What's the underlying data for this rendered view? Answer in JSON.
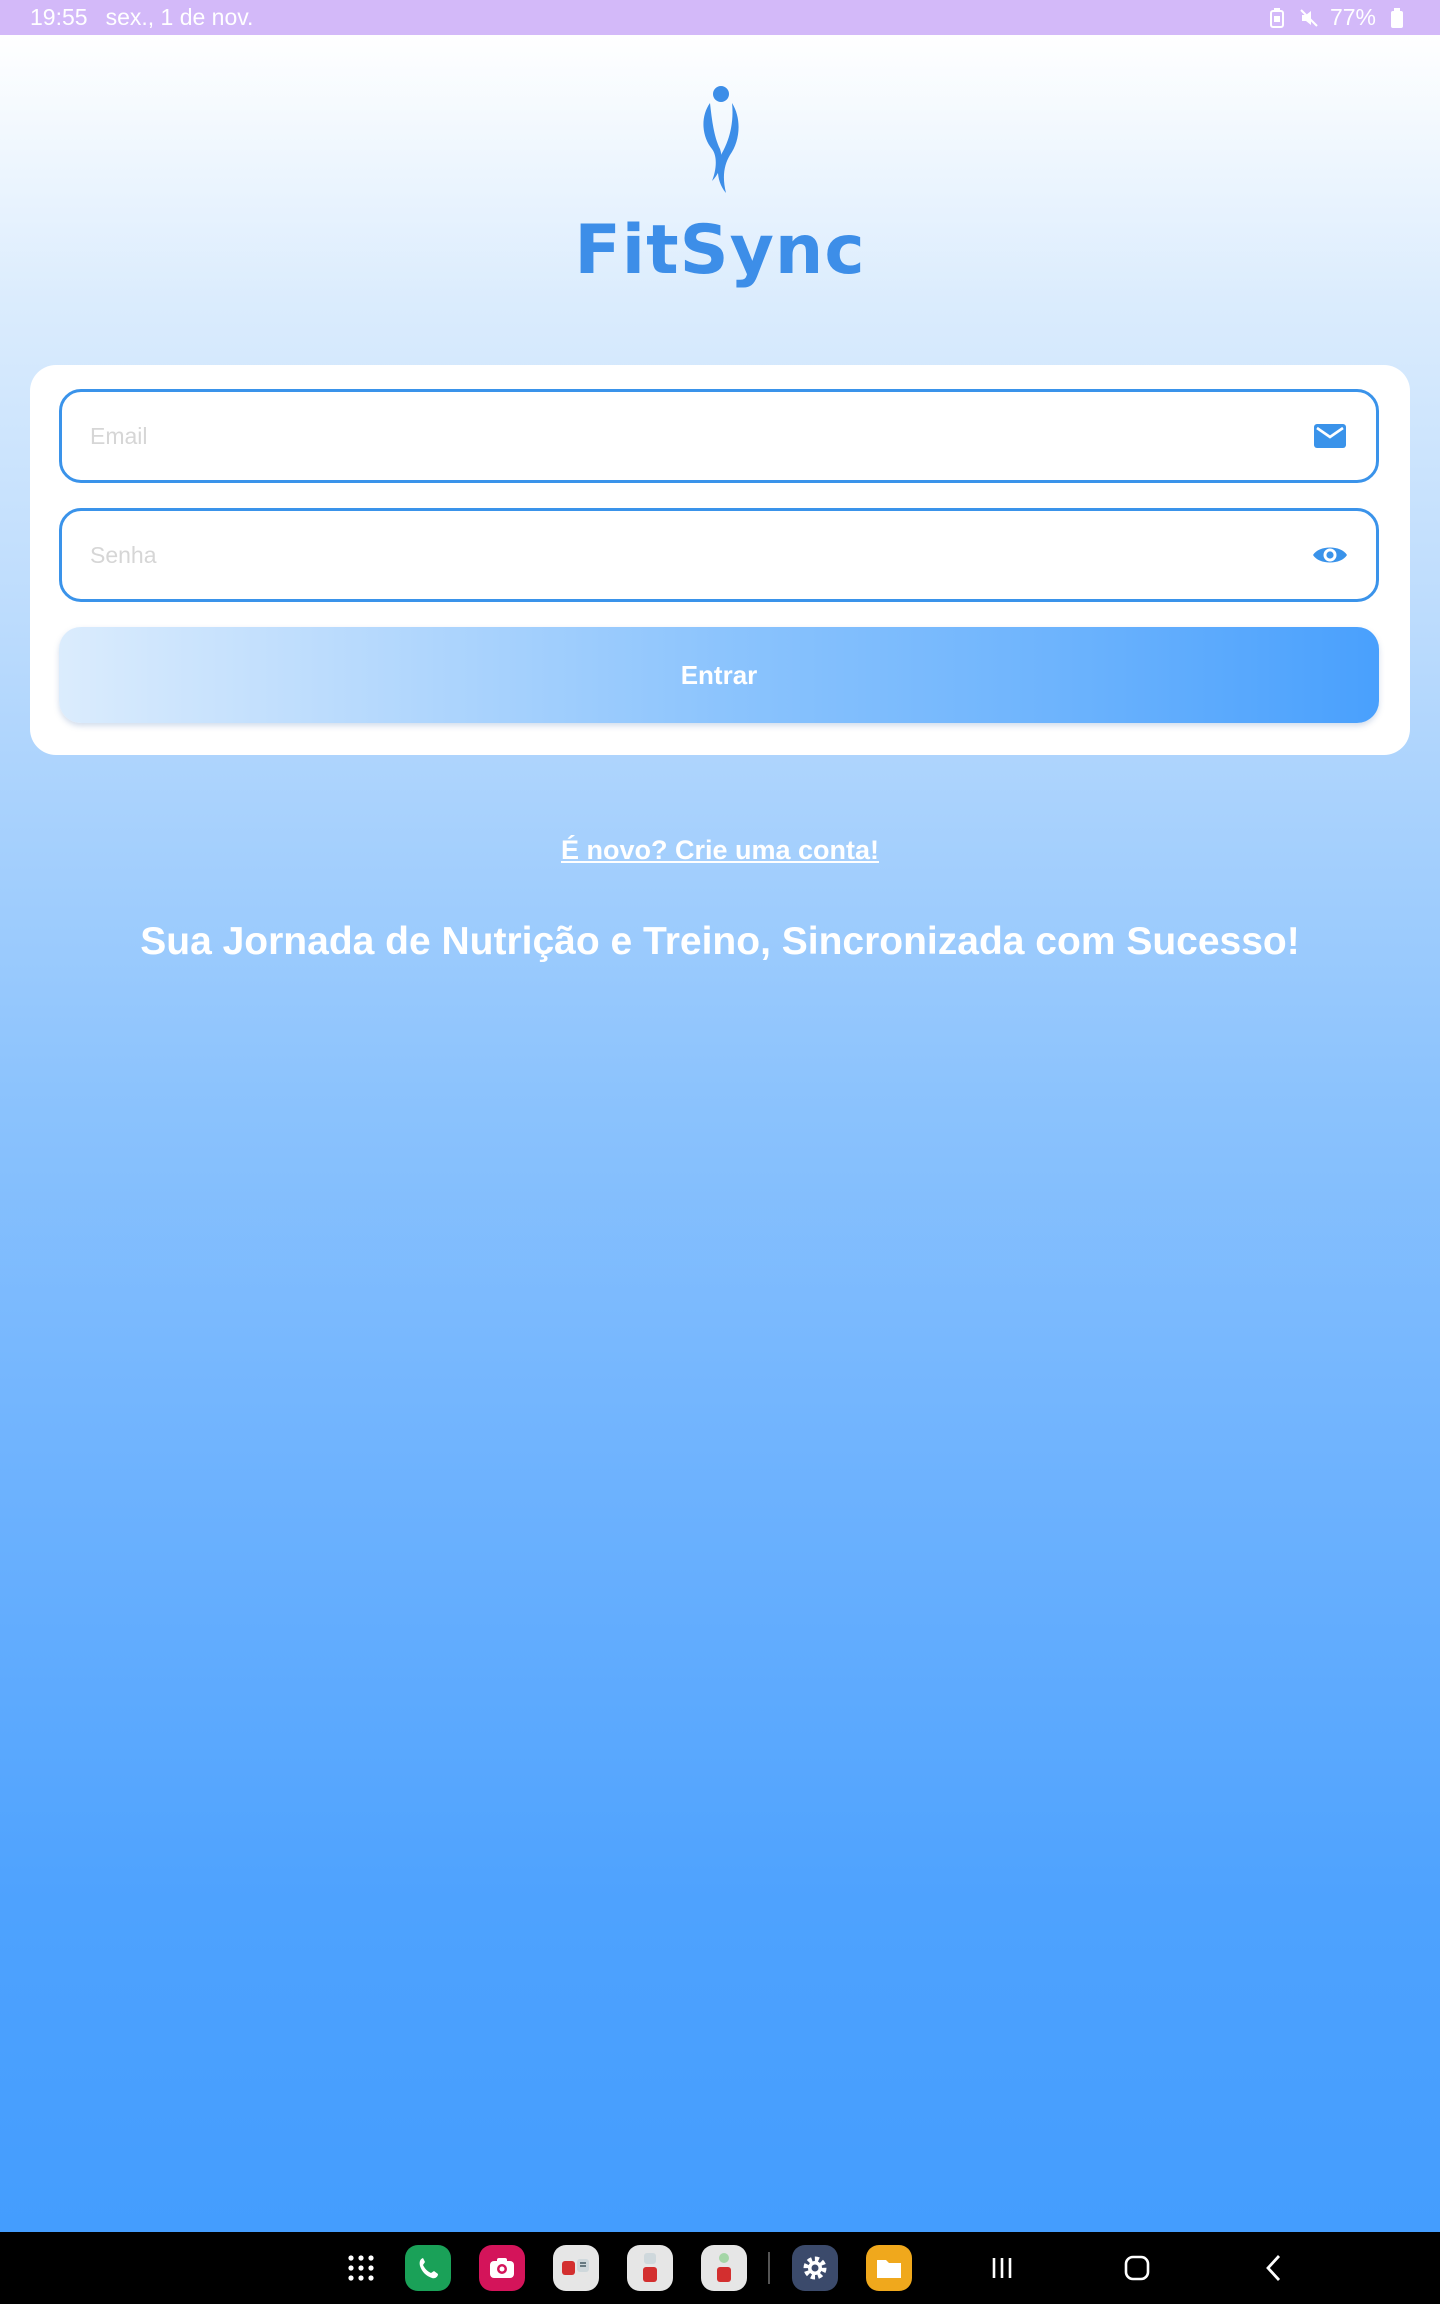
{
  "status_bar": {
    "time": "19:55",
    "date": "sex., 1 de nov.",
    "battery": "77%",
    "icons": [
      "battery-saver-icon",
      "mute-icon",
      "battery-icon"
    ]
  },
  "logo": {
    "text": "FitSync",
    "icon": "figure-logo-icon",
    "color": "#3d8ee8"
  },
  "login_form": {
    "email_placeholder": "Email",
    "email_icon": "mail-icon",
    "password_placeholder": "Senha",
    "password_icon": "eye-icon",
    "submit_label": "Entrar"
  },
  "signup_link": "É novo? Crie uma conta!",
  "tagline": "Sua Jornada de Nutrição e Treino, Sincronizada com Sucesso!",
  "nav_bar": {
    "apps": [
      "app-drawer-icon",
      "phone-app-icon",
      "camera-app-icon",
      "app-pair-1-icon",
      "app-pair-2-icon",
      "app-pair-3-icon",
      "settings-app-icon",
      "files-app-icon"
    ],
    "system": [
      "recents-icon",
      "home-icon",
      "back-icon"
    ]
  },
  "colors": {
    "accent": "#3a93ea",
    "status_bar": "#d3b9f9",
    "gradient_bottom": "#449dfe"
  }
}
